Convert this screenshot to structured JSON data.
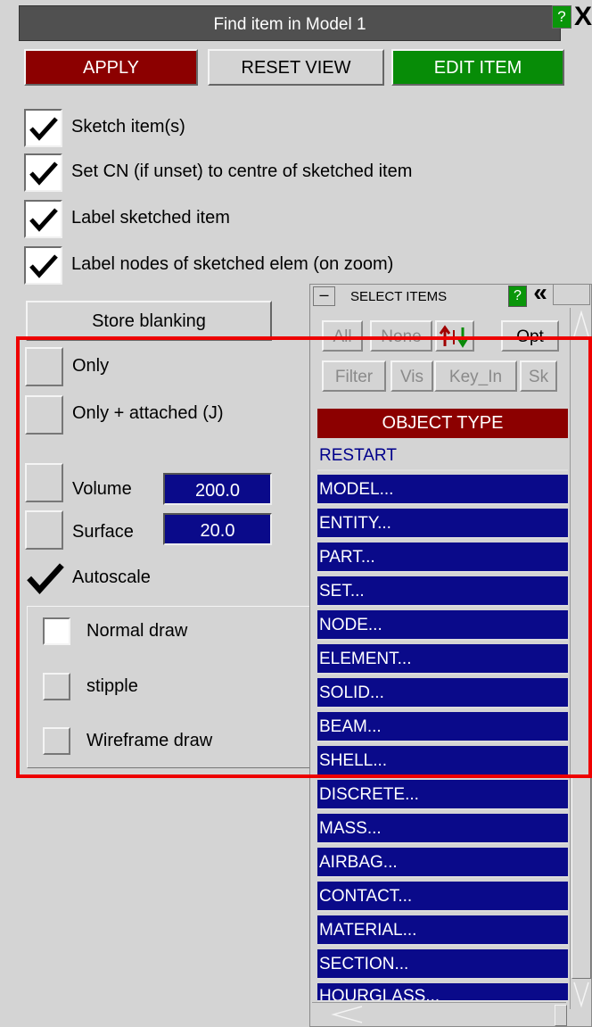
{
  "dialog": {
    "title": "Find item in Model 1",
    "help_label": "?",
    "close_label": "X"
  },
  "toolbar": {
    "apply_label": "APPLY",
    "reset_view_label": "RESET VIEW",
    "edit_item_label": "EDIT ITEM"
  },
  "options": [
    {
      "label": "Sketch item(s)",
      "checked": true
    },
    {
      "label": "Set CN (if unset) to centre of sketched item",
      "checked": true
    },
    {
      "label": "Label sketched item",
      "checked": true
    },
    {
      "label": "Label nodes of sketched elem (on zoom)",
      "checked": true
    }
  ],
  "blanking": {
    "store_label": "Store blanking",
    "only_label": "Only",
    "only_attached_label": "Only + attached (J)",
    "volume_label": "Volume",
    "volume_value": "200.0",
    "surface_label": "Surface",
    "surface_value": "20.0",
    "autoscale_label": "Autoscale",
    "autoscale_checked": true
  },
  "draw_mode": {
    "normal_label": "Normal draw",
    "stipple_label": "stipple",
    "wireframe_label": "Wireframe draw"
  },
  "selector": {
    "title": "SELECT ITEMS",
    "help_label": "?",
    "collapse_label": "«",
    "minimize_label": "–",
    "buttons_row1": [
      "All",
      "None",
      "Opt"
    ],
    "buttons_row2": [
      "Filter",
      "Vis",
      "Key_In",
      "Sk"
    ],
    "object_type_label": "OBJECT TYPE",
    "items": [
      "RESTART",
      "MODEL...",
      "ENTITY...",
      "PART...",
      "SET...",
      "NODE...",
      "ELEMENT...",
      "SOLID...",
      "BEAM...",
      "SHELL...",
      "DISCRETE...",
      "MASS...",
      "AIRBAG...",
      "CONTACT...",
      "MATERIAL...",
      "SECTION...",
      "HOURGLASS..."
    ]
  },
  "colors": {
    "apply": "#8c0000",
    "edit_item": "#078c07",
    "list_item": "#0a0a8a",
    "highlight": "#ee0000"
  }
}
